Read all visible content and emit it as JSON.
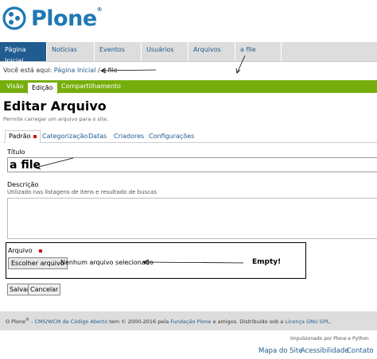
{
  "logo": {
    "text": "Plone",
    "reg": "®"
  },
  "nav": {
    "items": [
      "Página Inicial",
      "Notícias",
      "Eventos",
      "Usuários",
      "Arquivos",
      "a file"
    ]
  },
  "breadcrumb": {
    "prefix": "Você está aqui:",
    "home": "Página Inicial",
    "sep": "/",
    "current": "a file"
  },
  "editbar": {
    "items": [
      "Visão",
      "Edição",
      "Compartilhamento"
    ]
  },
  "page": {
    "title": "Editar Arquivo",
    "description": "Permite carregar um arquivo para o site."
  },
  "tabs": [
    "Padrão",
    "Categorização",
    "Datas",
    "Criadores",
    "Configurações"
  ],
  "form": {
    "title_label": "Título",
    "title_value": "a file",
    "desc_label": "Descrição",
    "desc_help": "Utilizado nas listagens de itens e resultado de buscas",
    "desc_value": "",
    "file_label": "Arquivo",
    "file_button": "Escolher arquivo",
    "file_status": "Nenhum arquivo selecionado",
    "save": "Salvar",
    "cancel": "Cancelar"
  },
  "annotation": {
    "empty": "Empty!"
  },
  "footer": {
    "p1": "O Plone",
    "reg": "®",
    "p2": " - ",
    "link1": "CMS/WCM de Código Aberto",
    "p3": " tem © 2000-2016 pela ",
    "link2": "Fundação Plone",
    "p4": " e amigos. Distribuído sob a ",
    "link3": "Licença GNU GPL",
    "p5": ".",
    "powered": "Impulsionado por Plone e Python",
    "links": [
      "Mapa do Site",
      "Acessibilidade",
      "Contato"
    ]
  },
  "colors": {
    "brand": "#1f78b4",
    "nav_active": "#205c90",
    "editbar": "#75ad0a",
    "required": "#dd0000"
  }
}
